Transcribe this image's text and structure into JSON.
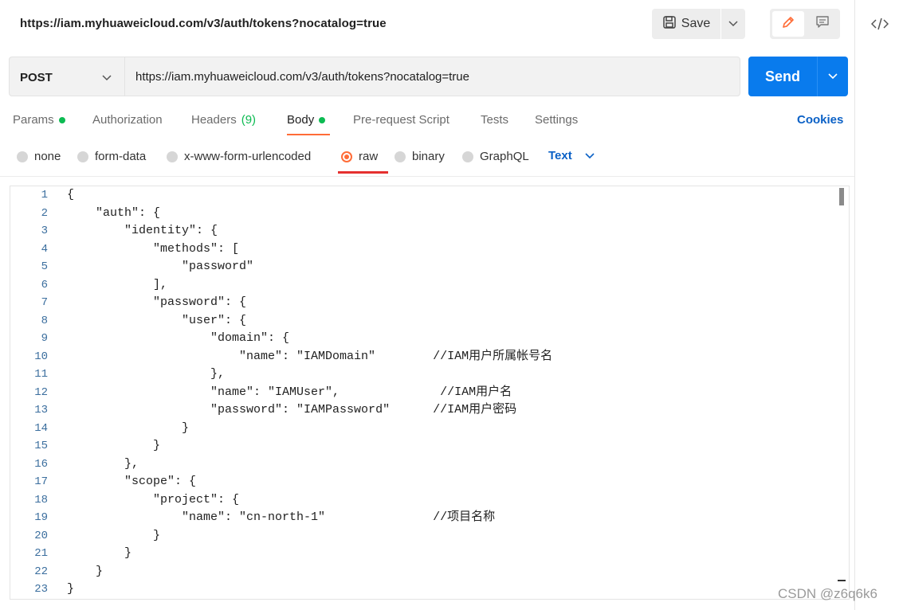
{
  "header": {
    "request_title": "https://iam.myhuaweicloud.com/v3/auth/tokens?nocatalog=true",
    "save_label": "Save"
  },
  "request": {
    "method": "POST",
    "url": "https://iam.myhuaweicloud.com/v3/auth/tokens?nocatalog=true",
    "send_label": "Send"
  },
  "tabs": [
    {
      "label": "Params",
      "dot": true
    },
    {
      "label": "Authorization"
    },
    {
      "label": "Headers",
      "count": "(9)"
    },
    {
      "label": "Body",
      "dot": true,
      "active": true
    },
    {
      "label": "Pre-request Script"
    },
    {
      "label": "Tests"
    },
    {
      "label": "Settings"
    }
  ],
  "cookies_label": "Cookies",
  "body_types": [
    {
      "label": "none"
    },
    {
      "label": "form-data"
    },
    {
      "label": "x-www-form-urlencoded"
    },
    {
      "label": "raw",
      "active": true
    },
    {
      "label": "binary"
    },
    {
      "label": "GraphQL"
    }
  ],
  "language_select": "Text",
  "editor": {
    "line_numbers": [
      "1",
      "2",
      "3",
      "4",
      "5",
      "6",
      "7",
      "8",
      "9",
      "10",
      "11",
      "12",
      "13",
      "14",
      "15",
      "16",
      "17",
      "18",
      "19",
      "20",
      "21",
      "22",
      "23"
    ],
    "lines": [
      "{",
      "    \"auth\": {",
      "        \"identity\": {",
      "            \"methods\": [",
      "                \"password\"",
      "            ],",
      "            \"password\": {",
      "                \"user\": {",
      "                    \"domain\": {",
      "                        \"name\": \"IAMDomain\"        //IAM用户所属帐号名",
      "                    },",
      "                    \"name\": \"IAMUser\",              //IAM用户名",
      "                    \"password\": \"IAMPassword\"      //IAM用户密码",
      "                }",
      "            }",
      "        },",
      "        \"scope\": {",
      "            \"project\": {",
      "                \"name\": \"cn-north-1\"               //项目名称",
      "            }",
      "        }",
      "    }",
      "}"
    ]
  },
  "watermark": "CSDN @z6q6k6",
  "colors": {
    "accent": "#ff6c37",
    "primary": "#097bed",
    "status_dot": "#0cbb52",
    "link": "#0b61c6"
  }
}
